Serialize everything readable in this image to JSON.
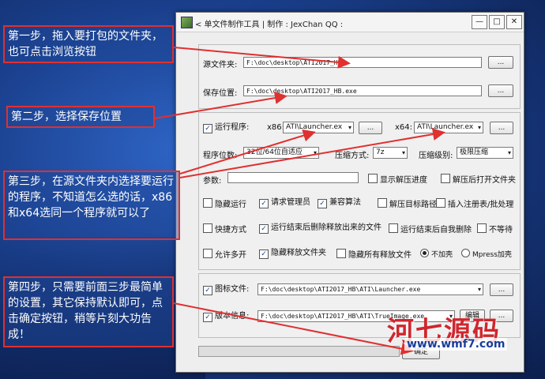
{
  "window": {
    "title": "< 单文件制作工具 | 制作 : JexChan  QQ :",
    "min": "—",
    "max": "□",
    "close": "✕"
  },
  "source": {
    "label": "源文件夹:",
    "value": "F:\\doc\\desktop\\ATI2017_HB",
    "browse": "..."
  },
  "save": {
    "label": "保存位置:",
    "value": "F:\\doc\\desktop\\ATI2017_HB.exe",
    "browse": "..."
  },
  "run": {
    "label": "运行程序:",
    "checked": "✓",
    "x86_label": "x86:",
    "x86_value": "ATI\\Launcher.ex",
    "x64_label": "x64:",
    "x64_value": "ATI\\Launcher.ex",
    "browse": "...",
    "arrow": "▾"
  },
  "options_row": {
    "bits_label": "程序位数:",
    "bits_value": "32位/64位自适应",
    "compress_label": "压缩方式:",
    "compress_value": "7z",
    "level_label": "压缩级别:",
    "level_value": "极限压缩"
  },
  "params": {
    "label": "参数:",
    "value": "",
    "show_progress": "显示解压进度",
    "open_folder": "解压后打开文件夹"
  },
  "checks_row1": {
    "hide_run": "隐藏运行",
    "request_admin": "请求管理员",
    "compat": "兼容算法",
    "extract_dir": "解压目标路径",
    "registry": "插入注册表/批处理"
  },
  "checks_row2": {
    "shortcut": "快捷方式",
    "delete_after": "运行结束后删除释放出来的文件",
    "self_delete": "运行结束后自我删除",
    "no_wait": "不等待"
  },
  "checks_row3": {
    "multi_open": "允许多开",
    "hide_release": "隐藏释放文件夹",
    "hide_all": "隐藏所有释放文件",
    "no_shell": "不加壳",
    "mpress": "Mpress加壳"
  },
  "icon_file": {
    "label": "图标文件:",
    "value": "F:\\doc\\desktop\\ATI2017_HB\\ATI\\Launcher.exe",
    "browse": "..."
  },
  "version_info": {
    "label": "版本信息:",
    "value": "F:\\doc\\desktop\\ATI2017_HB\\ATI\\TrueImage.exe",
    "edit": "编辑",
    "browse": "..."
  },
  "confirm_button": "确定",
  "annotations": {
    "step1": "第一步，拖入要打包的文件夹，也可点击浏览按钮",
    "step2": "第二步，选择保存位置",
    "step3": "第三步，在源文件夹内选择要运行的程序，不知道怎么选的话，x86和x64选同一个程序就可以了",
    "step4": "第四步，只需要前面三步最简单的设置，其它保持默认即可，点击确定按钮，稍等片刻大功告成！"
  },
  "watermark": {
    "brand": "河七源码",
    "url": "www.wmf7.com"
  },
  "colors": {
    "annotation_border": "#e03030",
    "desktop": "#1a3f8c",
    "window_bg": "#eeeeee"
  }
}
